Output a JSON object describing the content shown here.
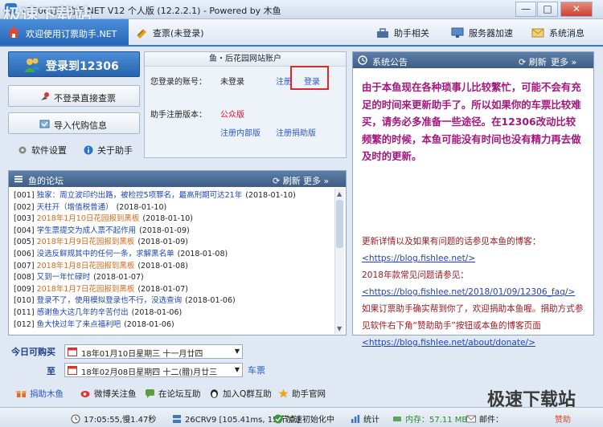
{
  "window": {
    "title": "12306订票助手.NET V12 个人版 (12.2.2.1) - Powered by 木鱼",
    "min": "—",
    "max": "□",
    "close": "✕"
  },
  "tabs": {
    "active": "欢迎使用订票助手.NET",
    "query": "查票(未登录)",
    "helper": "助手相关",
    "server": "服务器加速",
    "msg": "系统消息"
  },
  "left": {
    "login": "登录到12306",
    "nologin": "不登录直接查票",
    "import": "导入代购信息",
    "settings": "软件设置",
    "about": "关于助手"
  },
  "account": {
    "header": "鱼・后花园网站账户",
    "label_account": "您登录的账号：",
    "value_account": "未登录",
    "register": "注册",
    "login": "登录",
    "label_version": "助手注册版本：",
    "value_version": "公众版",
    "register_internal": "注册内部版",
    "register_donate": "注册捐助版"
  },
  "forum": {
    "title": "鱼的论坛",
    "refresh": "刷新",
    "more": "更多",
    "items": [
      {
        "id": "[001]",
        "title": "独家：周立波印约出路，被检控5项罪名，最高刑期可达21年",
        "date": "(2018-01-10)",
        "orange": false
      },
      {
        "id": "[002]",
        "title": "天柱开（增值税普通）",
        "date": "(2018-01-10)",
        "orange": false
      },
      {
        "id": "[003]",
        "title": "2018年1月10日花园报到黑板",
        "date": "(2018-01-10)",
        "orange": true
      },
      {
        "id": "[004]",
        "title": "学生票提交为成人票不起作用",
        "date": "(2018-01-09)",
        "orange": false
      },
      {
        "id": "[005]",
        "title": "2018年1月9日花园报到黑板",
        "date": "(2018-01-09)",
        "orange": true
      },
      {
        "id": "[006]",
        "title": "没选反鲜规其中的任何一条，求解黑名单",
        "date": "(2018-01-08)",
        "orange": false
      },
      {
        "id": "[007]",
        "title": "2018年1月8日花园报到黑板",
        "date": "(2018-01-08)",
        "orange": true
      },
      {
        "id": "[008]",
        "title": "又到一年忙碌时",
        "date": "(2018-01-07)",
        "orange": false
      },
      {
        "id": "[009]",
        "title": "2018年1月7日花园报到黑板",
        "date": "(2018-01-07)",
        "orange": true
      },
      {
        "id": "[010]",
        "title": "登录不了，使用模拟登录也不行，没选查询",
        "date": "(2018-01-06)",
        "orange": false
      },
      {
        "id": "[011]",
        "title": "感谢鱼大这几年的辛苦付出",
        "date": "(2018-01-06)",
        "orange": false
      },
      {
        "id": "[012]",
        "title": "鱼大快过年了来点福利吧",
        "date": "(2018-01-06)",
        "orange": false
      }
    ]
  },
  "notice": {
    "title": "系统公告",
    "refresh": "刷新",
    "more": "更多",
    "bold": "由于本鱼现在各种琐事儿比较繁忙，可能不会有充足的时间来更新助手了。所以如果你的车票比较难买，请务必多准备一些途径。在12306改动比较频繁的时候，本鱼可能没有时间也没有精力再去做及时的更新。",
    "p1": "更新详情以及如果有问题的话参见本鱼的博客：",
    "url1": "<https://blog.fishlee.net/>",
    "p2": "2018年款常见问题请参见：",
    "url2": "<https://blog.fishlee.net/2018/01/09/12306_faq/>",
    "p3": "如果订票助手确实帮到你了，欢迎捐助本鱼喔。捐助方式参见软件右下角“赞助助手”按钮或本鱼的博客页面",
    "url3": "<https://blog.fishlee.net/about/donate/>"
  },
  "dates": {
    "today_label": "今日可购买",
    "today_value": "18年01月10日星期三 十一月廿四",
    "to_label": "至",
    "to_value": "18年02月08日星期四 十二(腊)月廿三",
    "ticket": "车票"
  },
  "links": {
    "donate": "捐助木鱼",
    "weibo": "微博关注鱼",
    "forum": "在论坛互助",
    "qq": "加入Q群互助",
    "site": "助手官网"
  },
  "status": {
    "time": "17:05:55,慢1.47秒",
    "train": "26CRV9 [105.41ms, 15 节点]",
    "accel": "加速初始化中",
    "stats": "统计",
    "mem": "内存：57.11 MB",
    "mail": "邮件：",
    "sponsor": "赞助"
  },
  "watermarks": {
    "top": "极速下载站",
    "bottom": "极速下载站"
  },
  "colors": {
    "accent": "#2866b7",
    "notice_bold": "#a4177f",
    "notice_body": "#9c1a23",
    "link": "#2a59c4"
  }
}
